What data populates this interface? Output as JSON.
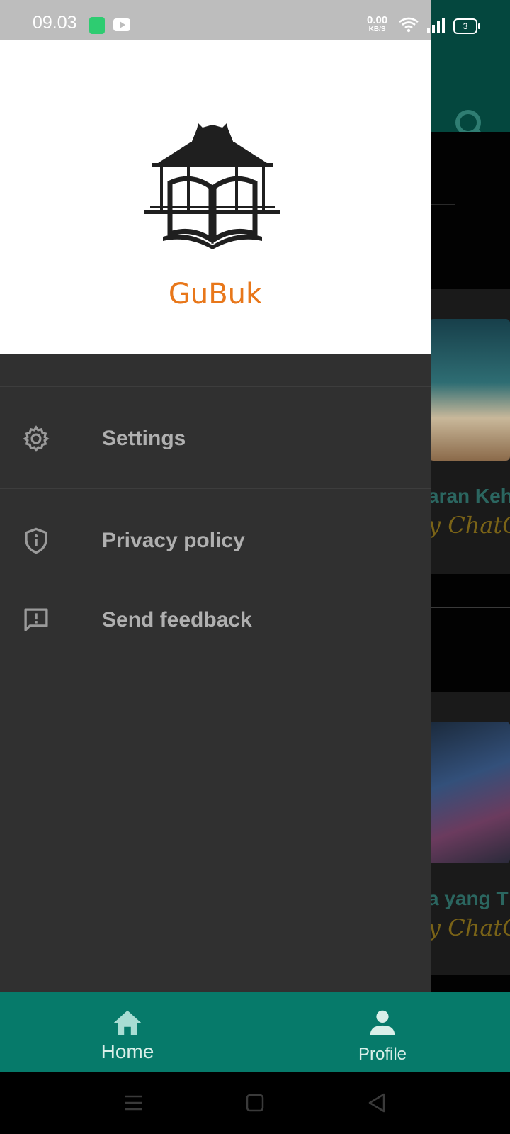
{
  "status_bar": {
    "time": "09.03",
    "net_speed_value": "0.00",
    "net_speed_unit": "KB/S",
    "battery_level": "3"
  },
  "drawer": {
    "app_name": "GuBuk",
    "menu": [
      {
        "label": "Settings",
        "icon": "gear-icon"
      },
      {
        "label": "Privacy policy",
        "icon": "shield-info-icon"
      },
      {
        "label": "Send feedback",
        "icon": "feedback-icon"
      }
    ]
  },
  "background": {
    "card1_title": "aran Keh",
    "card1_subtitle": "y ChatGP",
    "card2_title": "a yang T",
    "card2_subtitle": "y ChatGP"
  },
  "bottom_nav": {
    "items": [
      {
        "label": "Home",
        "icon": "home-icon"
      },
      {
        "label": "Profile",
        "icon": "person-icon"
      }
    ]
  },
  "colors": {
    "accent": "#067a6a",
    "brand_text": "#e8771a",
    "drawer_bg": "#303030"
  }
}
